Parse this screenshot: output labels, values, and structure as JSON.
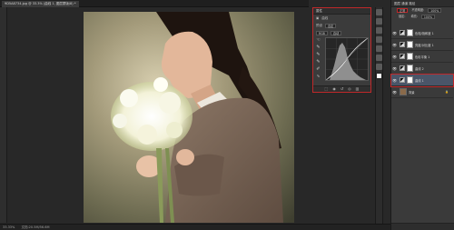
{
  "document": {
    "tab_title": "9D5A8734.jpg @ 33.3% (曲线 1, 图层蒙版/8) *"
  },
  "status_bar": {
    "zoom": "33.33%",
    "doc_info": "文档:20.5M/56.6M"
  },
  "properties_panel": {
    "header": "属性",
    "adjustment_name": "曲线",
    "preset_label": "预设",
    "preset_value": "自定",
    "channel_value": "RGB",
    "auto_label": "自动",
    "tool_icons": [
      "pointer-adjust-icon",
      "eyedropper-black-icon",
      "eyedropper-gray-icon",
      "eyedropper-white-icon",
      "pencil-icon",
      "smooth-icon",
      "warning-icon"
    ],
    "footer_icons": [
      "clip-icon",
      "view-prev-icon",
      "reset-icon",
      "visibility-icon",
      "trash-icon"
    ]
  },
  "layers_panel": {
    "tabs": "图层  通道  路径",
    "blend_mode": "正常",
    "opacity_label": "不透明度:",
    "opacity_value": "100%",
    "lock_label": "锁定:",
    "fill_label": "填充:",
    "fill_value": "100%",
    "layers": [
      {
        "name": "色相/饱和度 1",
        "kind": "adjustment",
        "visible": true,
        "selected": false
      },
      {
        "name": "亮度/对比度 1",
        "kind": "adjustment",
        "visible": true,
        "selected": false
      },
      {
        "name": "色彩平衡 1",
        "kind": "adjustment",
        "visible": true,
        "selected": false
      },
      {
        "name": "曲线 2",
        "kind": "adjustment",
        "visible": true,
        "selected": false
      },
      {
        "name": "曲线 1",
        "kind": "adjustment",
        "visible": true,
        "selected": true
      },
      {
        "name": "背景",
        "kind": "background",
        "visible": true,
        "selected": false
      }
    ]
  },
  "colors": {
    "highlight_red": "#c0282a",
    "panel_bg": "#3a3a3a",
    "workspace_bg": "#282828"
  }
}
